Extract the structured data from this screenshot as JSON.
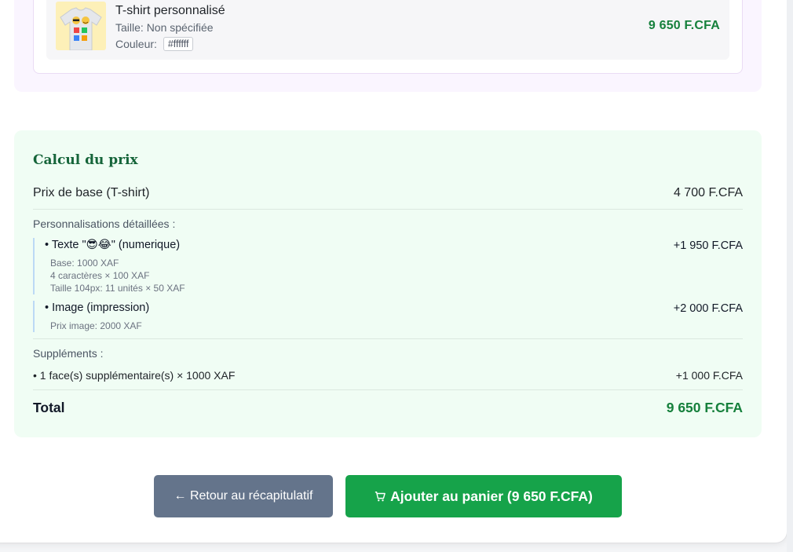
{
  "product": {
    "name": "T-shirt personnalisé",
    "size_label": "Taille:",
    "size_value": "Non spécifiée",
    "color_label": "Couleur:",
    "color_value": "#ffffff",
    "price": "9 650 F.CFA",
    "thumbnail_icon": "tshirt-emoji-design"
  },
  "calculation": {
    "title": "Calcul du prix",
    "base": {
      "label": "Prix de base (T-shirt)",
      "value": "4 700 F.CFA"
    },
    "details_label": "Personnalisations détaillées :",
    "items": [
      {
        "name": "• Texte \"😎😂\" (numerique)",
        "value": "+1 950 F.CFA",
        "subs": [
          "Base: 1000 XAF",
          "4 caractères × 100 XAF",
          "Taille 104px: 11 unités × 50 XAF"
        ]
      },
      {
        "name": "• Image (impression)",
        "value": "+2 000 F.CFA",
        "subs": [
          "Prix image: 2000 XAF"
        ]
      }
    ],
    "supplements_label": "Suppléments :",
    "supplement": {
      "label": "• 1 face(s) supplémentaire(s) × 1000 XAF",
      "value": "+1 000 F.CFA"
    },
    "total": {
      "label": "Total",
      "value": "9 650 F.CFA"
    }
  },
  "actions": {
    "back_label": "← Retour au récapitulatif",
    "add_label": "Ajouter au panier (9 650 F.CFA)",
    "add_icon": "shopping-cart-icon"
  },
  "colors": {
    "accent_green": "#16a34a",
    "price_green": "#16803c",
    "back_button": "#64748b",
    "calc_background": "#f0fdf4",
    "product_panel": "#faf5ff"
  }
}
